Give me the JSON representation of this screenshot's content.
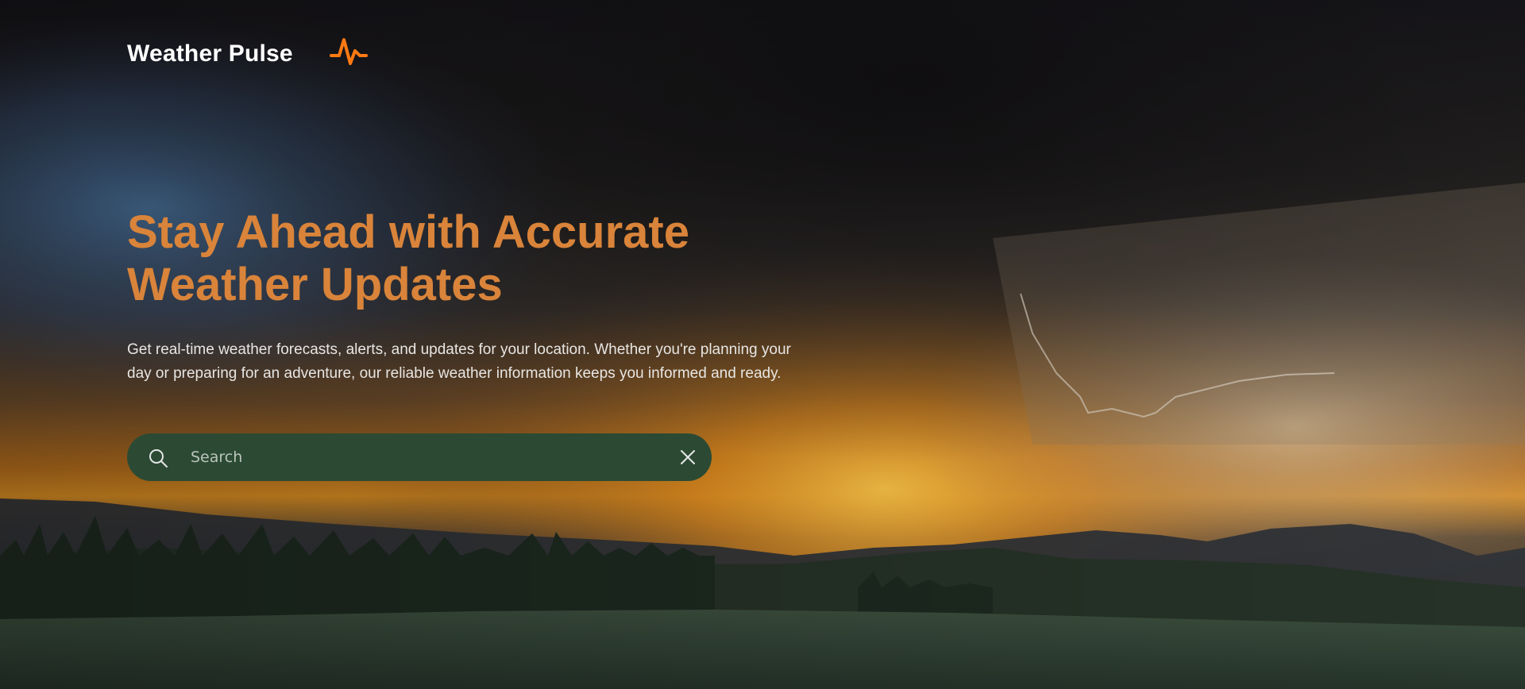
{
  "brand": {
    "name": "Weather Pulse",
    "accent_color": "#ff7a12",
    "icon": "pulse-icon"
  },
  "hero": {
    "headline": "Stay Ahead with Accurate Weather Updates",
    "description": "Get real-time weather forecasts, alerts, and updates for your location. Whether you're planning your day or preparing for an adventure, our reliable weather information keeps you informed and ready.",
    "headline_color": "#d9843a",
    "background": "storm clouds over mountains at sunset"
  },
  "search": {
    "placeholder": "Search",
    "value": "",
    "background_color": "#2c4a33",
    "icon": "search-icon",
    "clear_icon": "close-icon"
  }
}
